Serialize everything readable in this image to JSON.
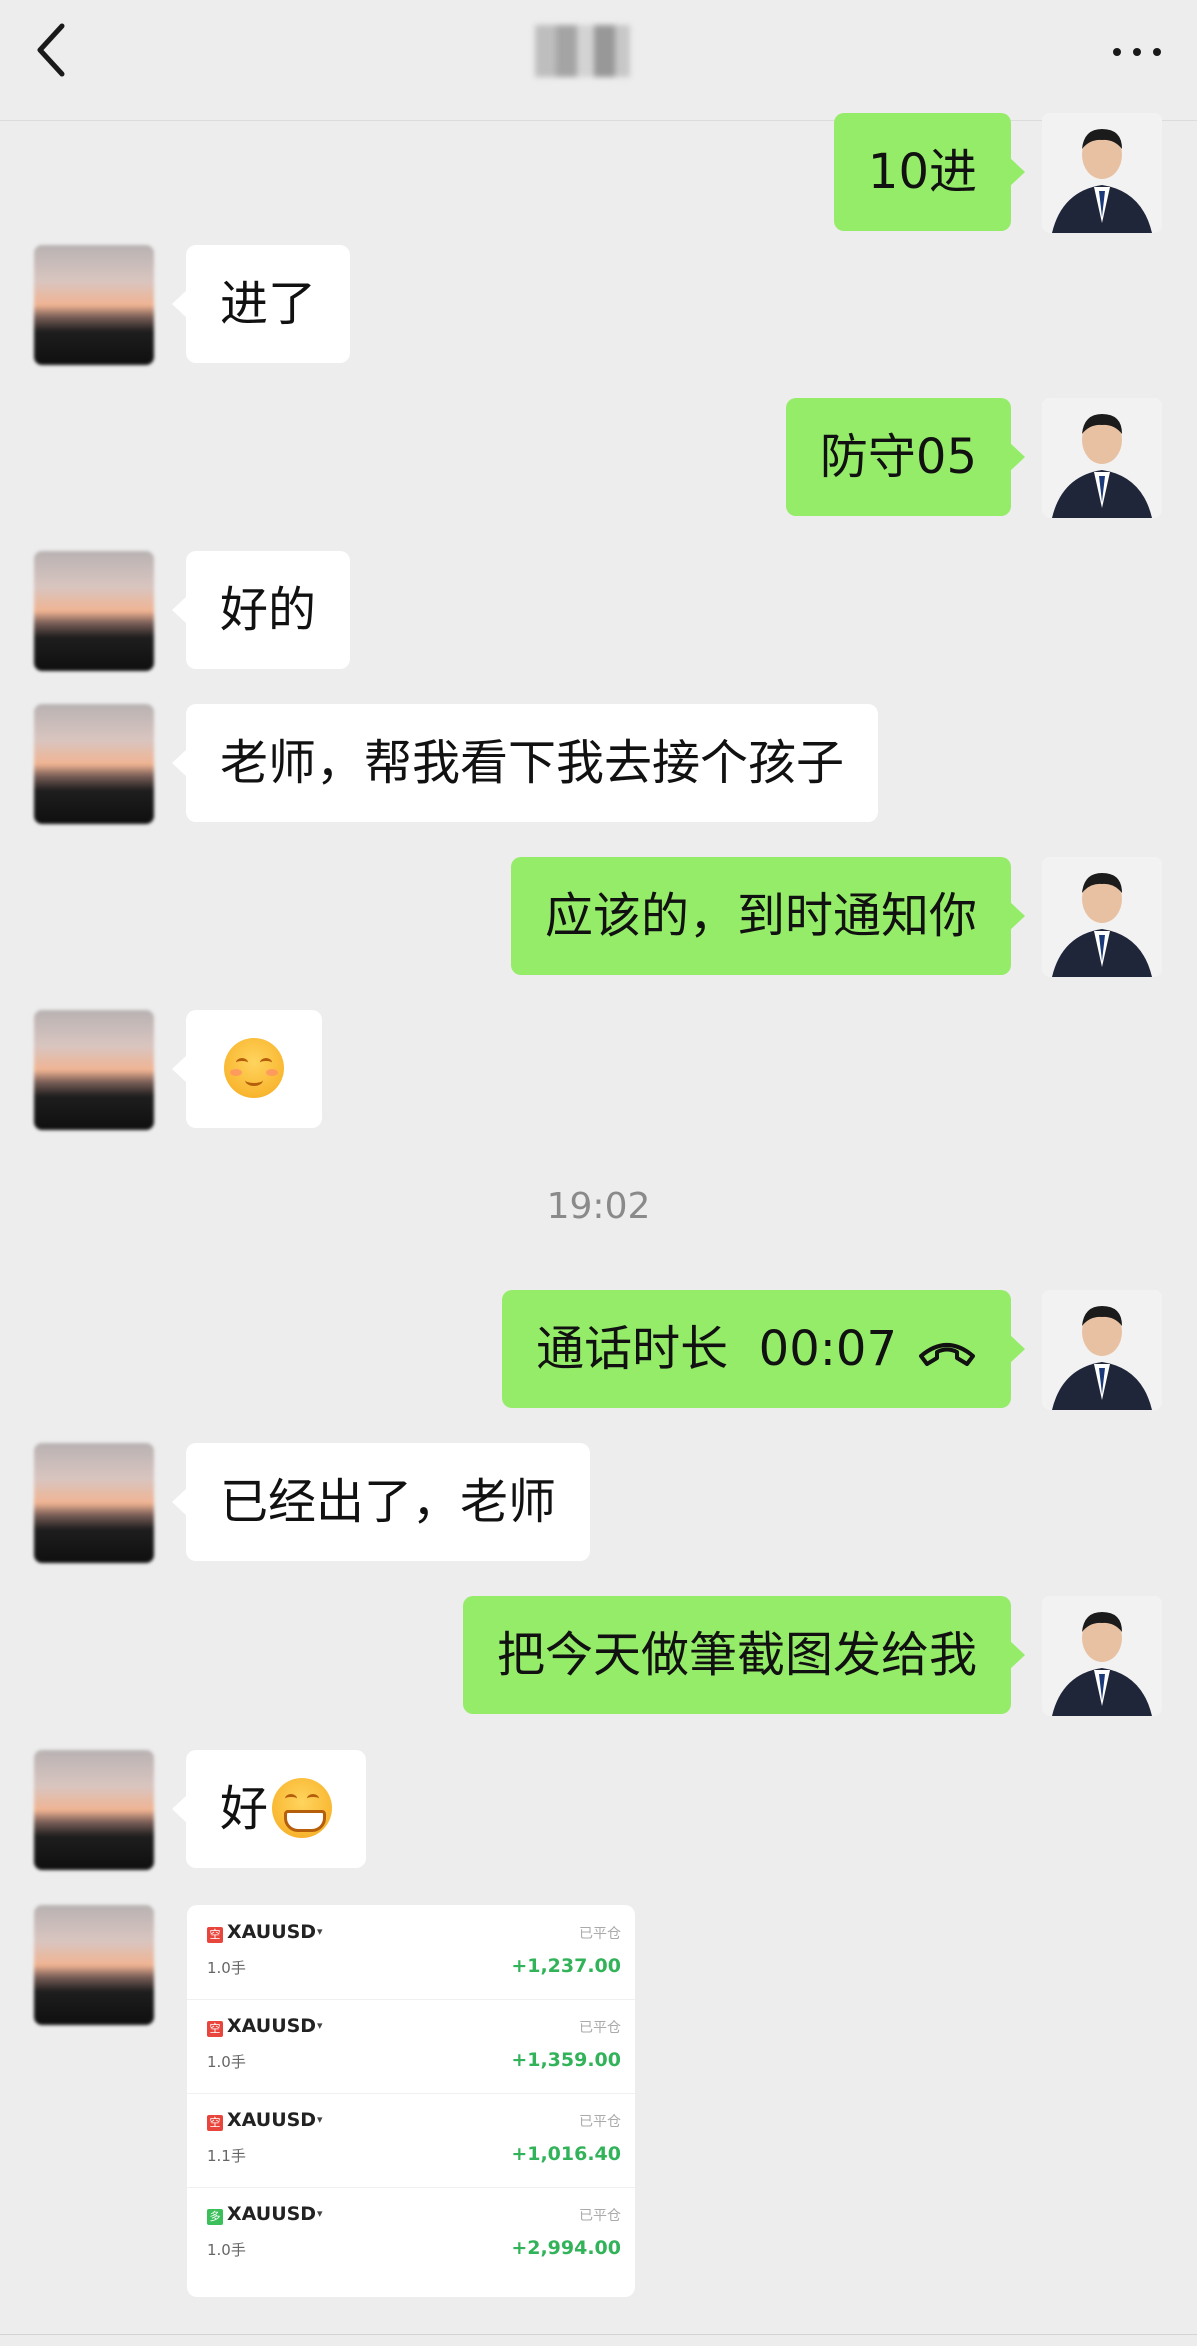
{
  "header": {
    "back_icon": "chevron-left-icon",
    "more_icon": "more-dots-icon"
  },
  "messages": [
    {
      "from": "me",
      "text": "10进"
    },
    {
      "from": "other",
      "text": "进了"
    },
    {
      "from": "me",
      "text": "防守05"
    },
    {
      "from": "other",
      "text": "好的"
    },
    {
      "from": "other",
      "text": "老师，帮我看下我去接个孩子"
    },
    {
      "from": "me",
      "text": "应该的，到时通知你"
    },
    {
      "from": "other",
      "emoji": "shy-smile-emoji"
    },
    {
      "from": "me",
      "text": "通话时长  00:07",
      "icon": "phone-hangup-icon"
    },
    {
      "from": "other",
      "text": "已经出了，老师"
    },
    {
      "from": "me",
      "text": "把今天做筆截图发给我"
    },
    {
      "from": "other",
      "text": "好",
      "emoji": "grin-emoji"
    }
  ],
  "timestamp": "19:02",
  "trade_card": {
    "trades": [
      {
        "tag": "空",
        "side": "short",
        "symbol": "XAUUSD",
        "lots": "1.0手",
        "status": "已平仓",
        "profit": "+1,237.00"
      },
      {
        "tag": "空",
        "side": "short",
        "symbol": "XAUUSD",
        "lots": "1.0手",
        "status": "已平仓",
        "profit": "+1,359.00"
      },
      {
        "tag": "空",
        "side": "short",
        "symbol": "XAUUSD",
        "lots": "1.1手",
        "status": "已平仓",
        "profit": "+1,016.40"
      },
      {
        "tag": "多",
        "side": "long",
        "symbol": "XAUUSD",
        "lots": "1.0手",
        "status": "已平仓",
        "profit": "+2,994.00"
      }
    ]
  },
  "colors": {
    "background": "#ededed",
    "outgoing_bubble": "#95ec69",
    "incoming_bubble": "#ffffff",
    "profit": "#32b35a",
    "short_tag": "#e8463c",
    "long_tag": "#3bbf5a"
  }
}
